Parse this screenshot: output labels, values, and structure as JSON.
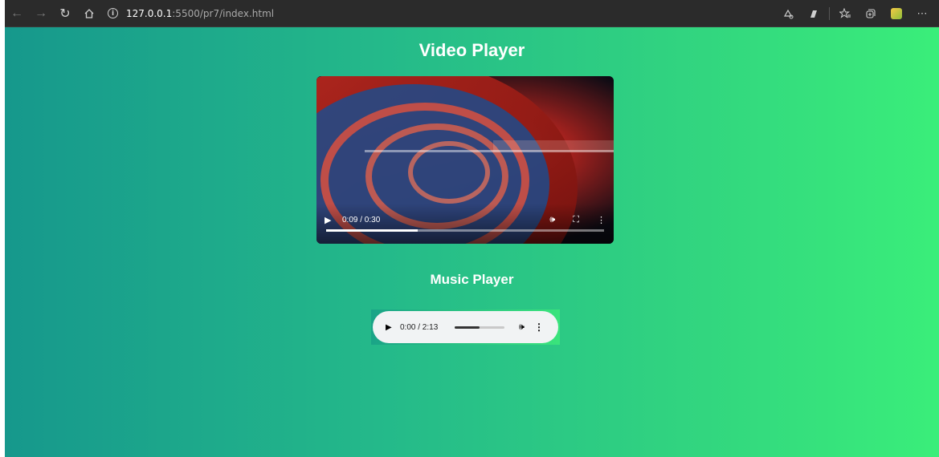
{
  "browser": {
    "back_icon": "arrow-left-icon",
    "forward_icon": "arrow-right-icon",
    "refresh_icon": "refresh-icon",
    "home_icon": "home-icon",
    "url_host": "127.0.0.1",
    "url_rest": ":5500/pr7/index.html",
    "right_icons": [
      "read-aloud-icon",
      "immersive-reader-icon",
      "favorites-icon",
      "collections-icon",
      "extension-icon",
      "more-icon"
    ]
  },
  "page": {
    "video_title": "Video Player",
    "music_title": "Music Player"
  },
  "video_player": {
    "time_display": "0:09 / 0:30",
    "progress": 0.33,
    "buffered": 0.92
  },
  "audio_player": {
    "time_display": "0:00 / 2:13",
    "progress": 0.0,
    "volume_level": 0.5
  },
  "colors": {
    "gradient_start": "#16988c",
    "gradient_end": "#3aee7a",
    "toolbar": "#2b2b2b"
  }
}
